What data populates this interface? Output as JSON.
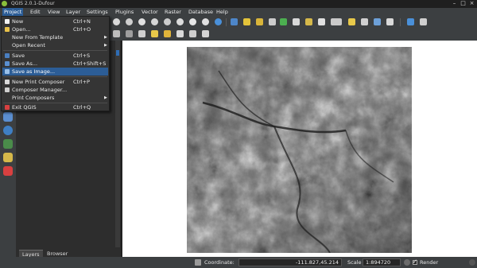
{
  "window": {
    "title": "QGIS 2.0.1-Dufour"
  },
  "menubar": {
    "items": [
      "Project",
      "Edit",
      "View",
      "Layer",
      "Settings",
      "Plugins",
      "Vector",
      "Raster",
      "Database",
      "Help"
    ]
  },
  "project_menu": {
    "items": [
      {
        "label": "New",
        "shortcut": "Ctrl+N",
        "icon": "new-file-icon"
      },
      {
        "label": "Open...",
        "shortcut": "Ctrl+O",
        "icon": "open-folder-icon"
      },
      {
        "label": "New From Template",
        "shortcut": "",
        "submenu": true
      },
      {
        "label": "Open Recent",
        "shortcut": "",
        "submenu": true
      },
      {
        "label": "Save",
        "shortcut": "Ctrl+S",
        "icon": "save-icon"
      },
      {
        "label": "Save As...",
        "shortcut": "Ctrl+Shift+S",
        "icon": "save-as-icon"
      },
      {
        "label": "Save as Image...",
        "shortcut": "",
        "highlighted": true,
        "icon": "image-icon"
      },
      {
        "label": "New Print Composer",
        "shortcut": "Ctrl+P",
        "icon": "print-composer-icon"
      },
      {
        "label": "Composer Manager...",
        "shortcut": "",
        "icon": "composer-manager-icon"
      },
      {
        "label": "Print Composers",
        "shortcut": "",
        "submenu": true
      },
      {
        "label": "Exit QGIS",
        "shortcut": "Ctrl+Q",
        "icon": "exit-icon"
      }
    ]
  },
  "panel_tabs": [
    "Layers",
    "Browser"
  ],
  "statusbar": {
    "coordinate_label": "Coordinate:",
    "coordinate_value": "-111.827,45.214",
    "scale_label": "Scale",
    "scale_value": "1:894720",
    "render_label": "Render"
  },
  "colors": {
    "menu_highlight": "#2c5d96",
    "chrome": "#3c3f41",
    "canvas": "#ffffff"
  }
}
